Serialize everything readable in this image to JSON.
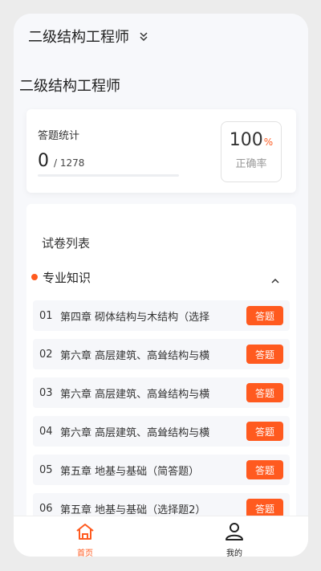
{
  "header": {
    "title": "二级结构工程师"
  },
  "page": {
    "title": "二级结构工程师"
  },
  "stats": {
    "label": "答题统计",
    "answered": "0",
    "total": "/ 1278",
    "progress": 0,
    "rate_value": "100",
    "rate_unit": "%",
    "rate_label": "正确率"
  },
  "list": {
    "title": "试卷列表",
    "section": "专业知识",
    "button_label": "答题",
    "items": [
      {
        "idx": "01",
        "title": "第四章 砌体结构与木结构（选择"
      },
      {
        "idx": "02",
        "title": "第六章 高层建筑、高耸结构与横"
      },
      {
        "idx": "03",
        "title": "第六章 高层建筑、高耸结构与横"
      },
      {
        "idx": "04",
        "title": "第六章 高层建筑、高耸结构与横"
      },
      {
        "idx": "05",
        "title": "第五章 地基与基础（简答题）"
      },
      {
        "idx": "06",
        "title": "第五章 地基与基础（选择题2）"
      }
    ]
  },
  "tabbar": {
    "home": "首页",
    "mine": "我的"
  },
  "colors": {
    "accent": "#ff5a1f"
  },
  "icons": {
    "dropdown": "double-chevron-down-icon",
    "collapse": "chevron-up-icon",
    "home": "home-icon",
    "mine": "user-icon"
  }
}
